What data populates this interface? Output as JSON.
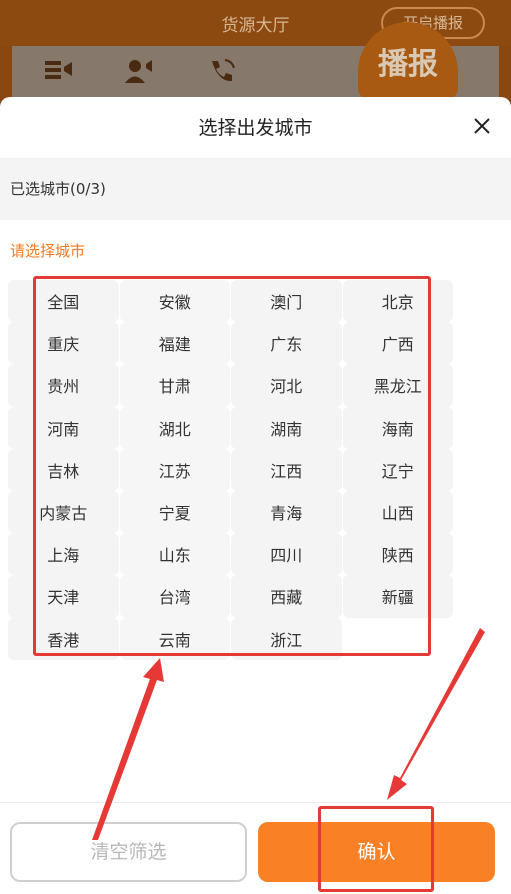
{
  "background": {
    "header_title": "货源大厅",
    "broadcast_toggle_label": "开启播报",
    "broadcast_badge_label": "播报",
    "icons": [
      "broadcast-list-icon",
      "user-broadcast-icon",
      "phone-broadcast-icon"
    ]
  },
  "sheet": {
    "title": "选择出发城市",
    "selected_label": "已选城市(0/3)",
    "prompt_label": "请选择城市",
    "cities": [
      "全国",
      "安徽",
      "澳门",
      "北京",
      "重庆",
      "福建",
      "广东",
      "广西",
      "贵州",
      "甘肃",
      "河北",
      "黑龙江",
      "河南",
      "湖北",
      "湖南",
      "海南",
      "吉林",
      "江苏",
      "江西",
      "辽宁",
      "内蒙古",
      "宁夏",
      "青海",
      "山西",
      "上海",
      "山东",
      "四川",
      "陕西",
      "天津",
      "台湾",
      "西藏",
      "新疆",
      "香港",
      "云南",
      "浙江"
    ],
    "clear_label": "清空筛选",
    "confirm_label": "确认"
  },
  "colors": {
    "accent": "#f98025",
    "prompt": "#f07a22",
    "annotation": "#e53935"
  }
}
